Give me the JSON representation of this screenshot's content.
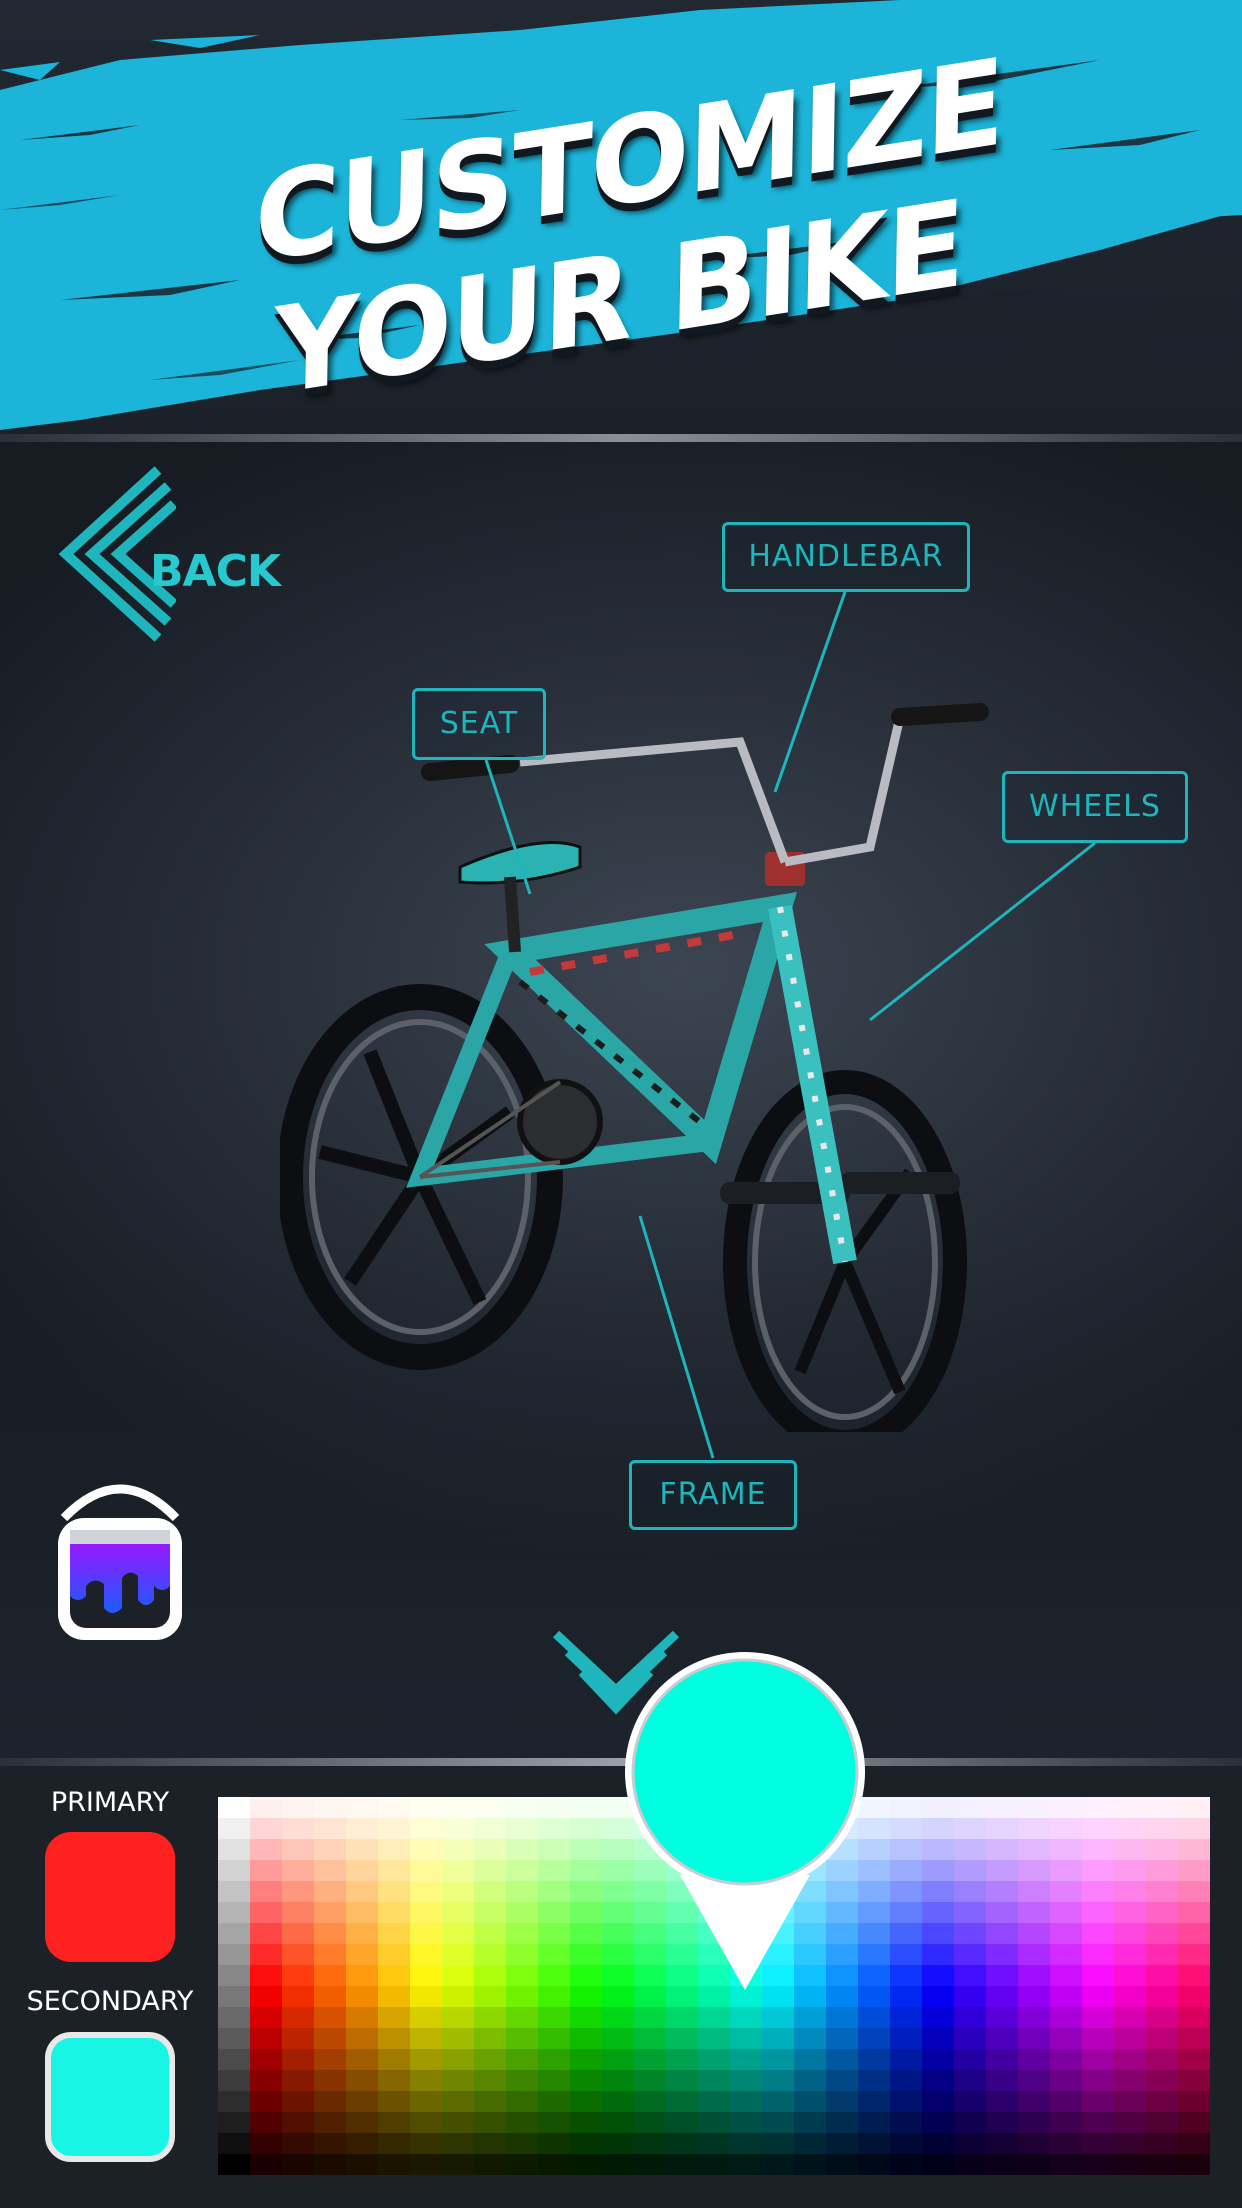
{
  "header": {
    "title_line1": "CUSTOMIZE",
    "title_line2": "YOUR BIKE",
    "accent_color": "#1cb4d8"
  },
  "scene": {
    "back_label": "BACK",
    "callouts": {
      "handlebar": "HANDLEBAR",
      "seat": "SEAT",
      "wheels": "WHEELS",
      "frame": "FRAME"
    },
    "paint_bucket_icon": "paint-bucket-icon",
    "expand_icon": "chevron-down-icon",
    "accent_color": "#1fb5bd"
  },
  "color_panel": {
    "primary_label": "PRIMARY",
    "primary_color": "#ff2020",
    "secondary_label": "SECONDARY",
    "secondary_color": "#19f5e4",
    "selected_color": "#00ffe1"
  }
}
